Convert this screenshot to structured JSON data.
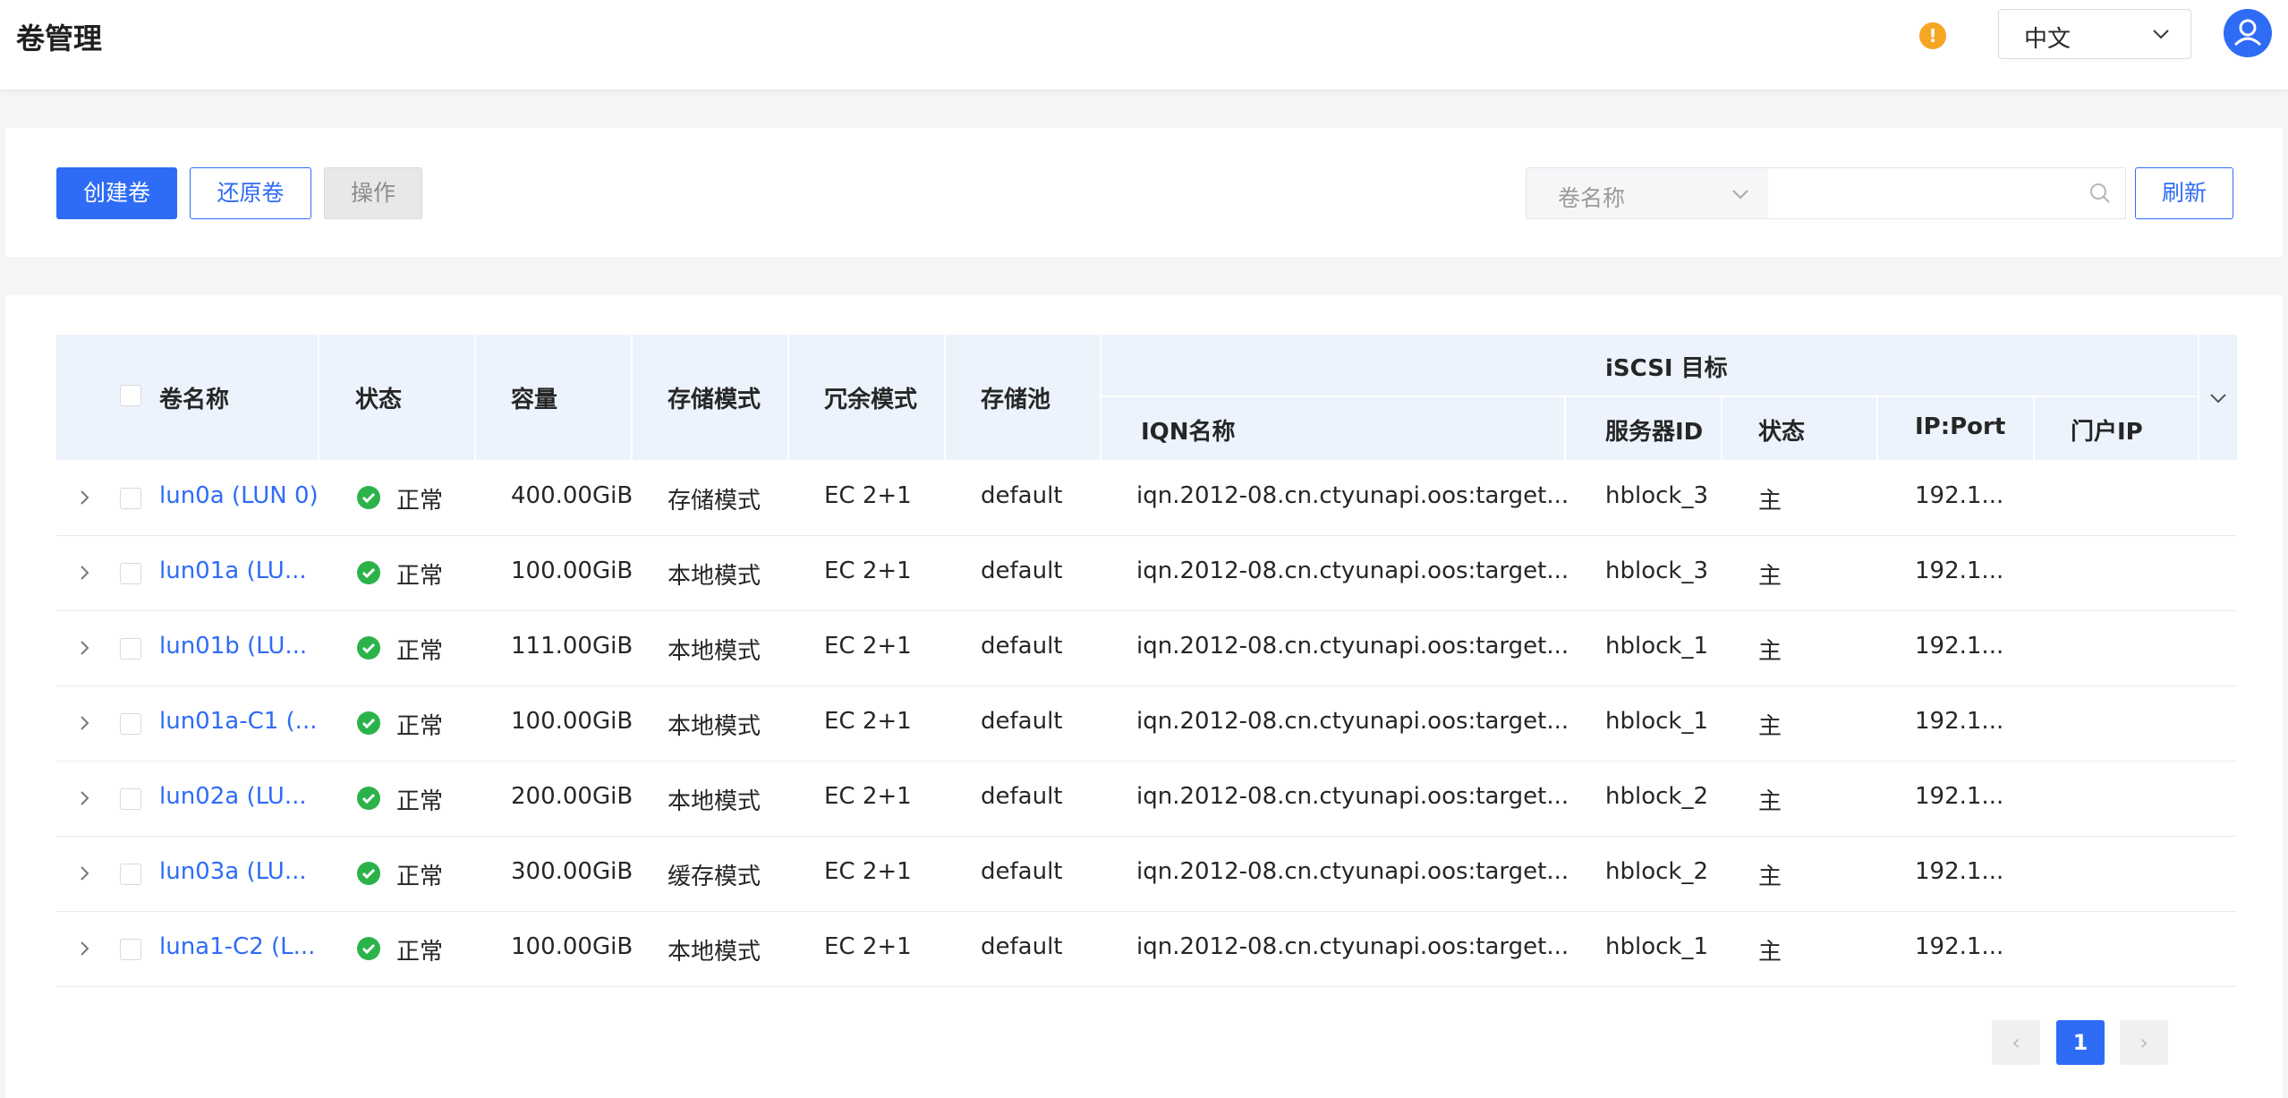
{
  "header": {
    "title": "卷管理",
    "language": "中文"
  },
  "toolbar": {
    "create_label": "创建卷",
    "restore_label": "还原卷",
    "action_label": "操作",
    "filter_value": "卷名称",
    "search_value": "",
    "refresh_label": "刷新"
  },
  "table": {
    "headers": {
      "name": "卷名称",
      "status": "状态",
      "capacity": "容量",
      "storage_mode": "存储模式",
      "redundancy": "冗余模式",
      "pool": "存储池",
      "iscsi_group": "iSCSI 目标",
      "iqn": "IQN名称",
      "server_id": "服务器ID",
      "role": "状态",
      "ip_port": "IP:Port",
      "portal_ip": "门户IP"
    },
    "rows": [
      {
        "name": "lun0a (LUN 0)",
        "status": "正常",
        "capacity": "400.00GiB",
        "mode": "存储模式",
        "redundancy": "EC 2+1",
        "pool": "default",
        "iqn": "iqn.2012-08.cn.ctyunapi.oos:target...",
        "server": "hblock_3",
        "role": "主",
        "ip": "192.1...",
        "portal": ""
      },
      {
        "name": "lun01a (LU...",
        "status": "正常",
        "capacity": "100.00GiB",
        "mode": "本地模式",
        "redundancy": "EC 2+1",
        "pool": "default",
        "iqn": "iqn.2012-08.cn.ctyunapi.oos:target...",
        "server": "hblock_3",
        "role": "主",
        "ip": "192.1...",
        "portal": ""
      },
      {
        "name": "lun01b (LU...",
        "status": "正常",
        "capacity": "111.00GiB",
        "mode": "本地模式",
        "redundancy": "EC 2+1",
        "pool": "default",
        "iqn": "iqn.2012-08.cn.ctyunapi.oos:target...",
        "server": "hblock_1",
        "role": "主",
        "ip": "192.1...",
        "portal": ""
      },
      {
        "name": "lun01a-C1 (...",
        "status": "正常",
        "capacity": "100.00GiB",
        "mode": "本地模式",
        "redundancy": "EC 2+1",
        "pool": "default",
        "iqn": "iqn.2012-08.cn.ctyunapi.oos:target...",
        "server": "hblock_1",
        "role": "主",
        "ip": "192.1...",
        "portal": ""
      },
      {
        "name": "lun02a (LU...",
        "status": "正常",
        "capacity": "200.00GiB",
        "mode": "本地模式",
        "redundancy": "EC 2+1",
        "pool": "default",
        "iqn": "iqn.2012-08.cn.ctyunapi.oos:target...",
        "server": "hblock_2",
        "role": "主",
        "ip": "192.1...",
        "portal": ""
      },
      {
        "name": "lun03a (LU...",
        "status": "正常",
        "capacity": "300.00GiB",
        "mode": "缓存模式",
        "redundancy": "EC 2+1",
        "pool": "default",
        "iqn": "iqn.2012-08.cn.ctyunapi.oos:target...",
        "server": "hblock_2",
        "role": "主",
        "ip": "192.1...",
        "portal": ""
      },
      {
        "name": "luna1-C2 (L...",
        "status": "正常",
        "capacity": "100.00GiB",
        "mode": "本地模式",
        "redundancy": "EC 2+1",
        "pool": "default",
        "iqn": "iqn.2012-08.cn.ctyunapi.oos:target...",
        "server": "hblock_1",
        "role": "主",
        "ip": "192.1...",
        "portal": ""
      }
    ]
  },
  "pagination": {
    "current_page": "1"
  },
  "colors": {
    "primary": "#2f6cf6",
    "success": "#2bb34a",
    "warning": "#f5a623",
    "header_bg": "#ecf3fc"
  },
  "icons": [
    "warning-icon",
    "chevron-down-icon",
    "user-icon",
    "search-icon",
    "chevron-right-icon",
    "check-circle-icon",
    "chevron-left-icon"
  ]
}
